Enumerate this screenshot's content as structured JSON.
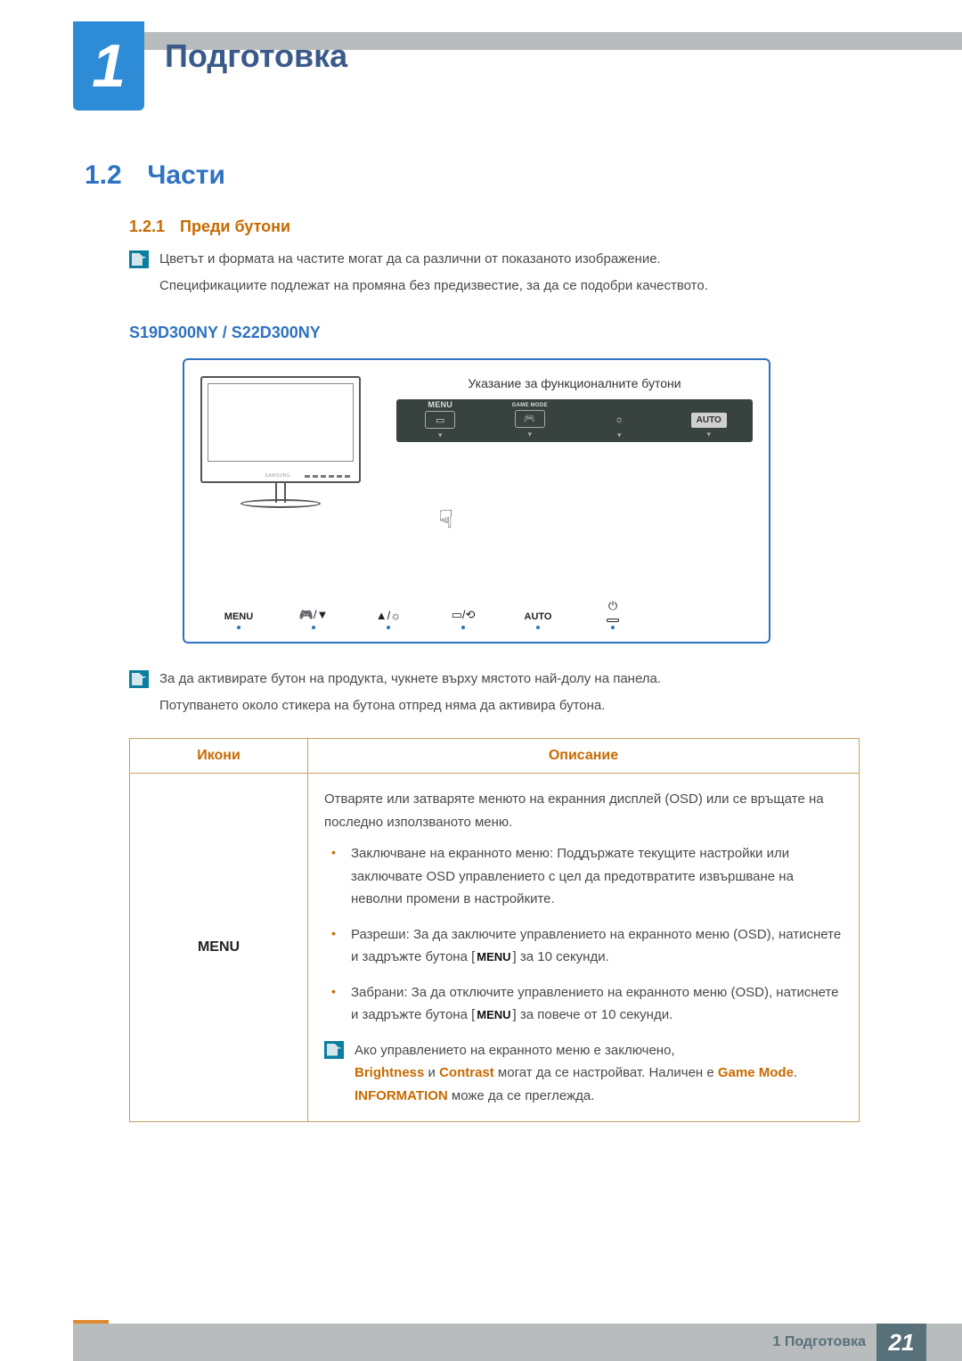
{
  "chapter": {
    "number": "1",
    "title": "Подготовка"
  },
  "section": {
    "number": "1.2",
    "title": "Части"
  },
  "subsection": {
    "number": "1.2.1",
    "title": "Преди бутони"
  },
  "notes1": {
    "line1": "Цветът и формата на частите могат да са различни от показаното изображение.",
    "line2": "Спецификациите подлежат на промяна без предизвестие, за да се подобри качеството."
  },
  "model_heading": "S19D300NY / S22D300NY",
  "diagram": {
    "callout": "Указание за функционалните бутони",
    "bar": {
      "menu": "MENU",
      "game": "GAME MODE",
      "auto": "AUTO"
    },
    "bottom": {
      "menu": "MENU",
      "auto": "AUTO"
    }
  },
  "notes2": {
    "line1": "За да активирате бутон на продукта, чукнете върху мястото най-долу на панела.",
    "line2": "Потупването около стикера на бутона отпред няма да активира бутона."
  },
  "table": {
    "headers": {
      "icons": "Икони",
      "desc": "Описание"
    },
    "row1": {
      "icon_label": "MENU",
      "intro": "Отваряте или затваряте менюто на екранния дисплей (OSD) или се връщате на последно използваното меню.",
      "b1": "Заключване на екранното меню: Поддържате текущите настройки или заключвате OSD управлението с цел да предотвратите извършване на неволни промени в настройките.",
      "b2_a": "Разреши: За да заключите управлението на екранното меню (OSD), натиснете и задръжте бутона [",
      "b2_b": "] за 10 секунди.",
      "b3_a": "Забрани: За да отключите управлението на екранното меню (OSD), натиснете и задръжте бутона [",
      "b3_b": "] за повече от 10 секунди.",
      "menu_inline": "MENU",
      "locked_line": "Ако управлението на екранното меню е заключено,",
      "locked2_a": "Brightness",
      "locked2_b": " и ",
      "locked2_c": "Contrast",
      "locked2_d": " могат да се настройват. Наличен е ",
      "locked2_e": "Game Mode",
      "locked2_f": ". ",
      "locked2_g": "INFORMATION",
      "locked2_h": " може да се преглежда."
    }
  },
  "footer": {
    "label": "1 Подготовка",
    "page": "21"
  }
}
